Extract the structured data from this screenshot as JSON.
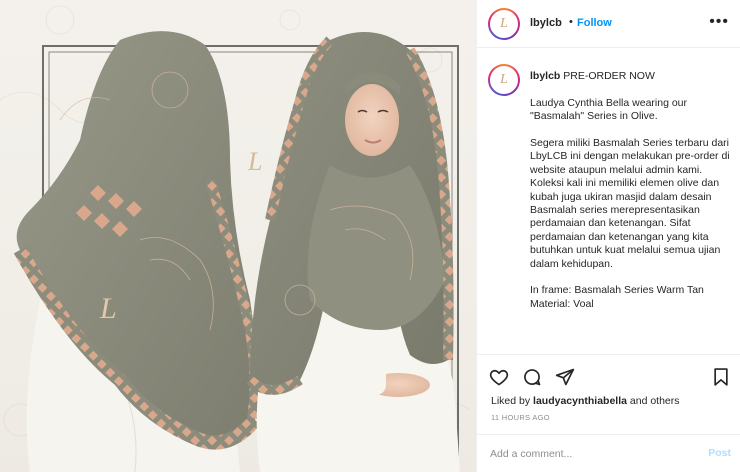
{
  "post": {
    "username": "lbylcb",
    "separator": "•",
    "follow_label": "Follow",
    "more_label": "•••",
    "avatar_letter": "L",
    "caption_first": "PRE-ORDER NOW",
    "caption_paragraphs": [
      "Laudya Cynthia Bella wearing our \"Basmalah\" Series in Olive.",
      "Segera miliki Basmalah Series terbaru dari LbyLCB ini dengan melakukan pre-order di website ataupun melalui admin kami. Koleksi kali ini memiliki elemen olive dan kubah juga ukiran masjid dalam desain Basmalah series merepresentasikan perdamaian dan ketenangan. Sifat perdamaian dan ketenangan yang kita butuhkan untuk kuat melalui semua ujian dalam kehidupan.",
      "In frame: Basmalah Series Warm Tan\nMaterial: Voal"
    ],
    "liked_prefix": "Liked by ",
    "liked_user": "laudyacynthiabella",
    "liked_suffix": " and others",
    "timestamp": "11 HOURS AGO",
    "comment_placeholder": "Add a comment...",
    "post_label": "Post"
  },
  "photo": {
    "monogram": "L"
  },
  "icons": {
    "like": "heart-icon",
    "comment": "comment-icon",
    "share": "share-icon",
    "save": "bookmark-icon"
  },
  "colors": {
    "link_blue": "#0095f6",
    "post_disabled": "#b2dffc",
    "muted": "#8e8e8e",
    "scarf_olive": "#8b8c7c",
    "scarf_pattern": "#d9a88c"
  }
}
